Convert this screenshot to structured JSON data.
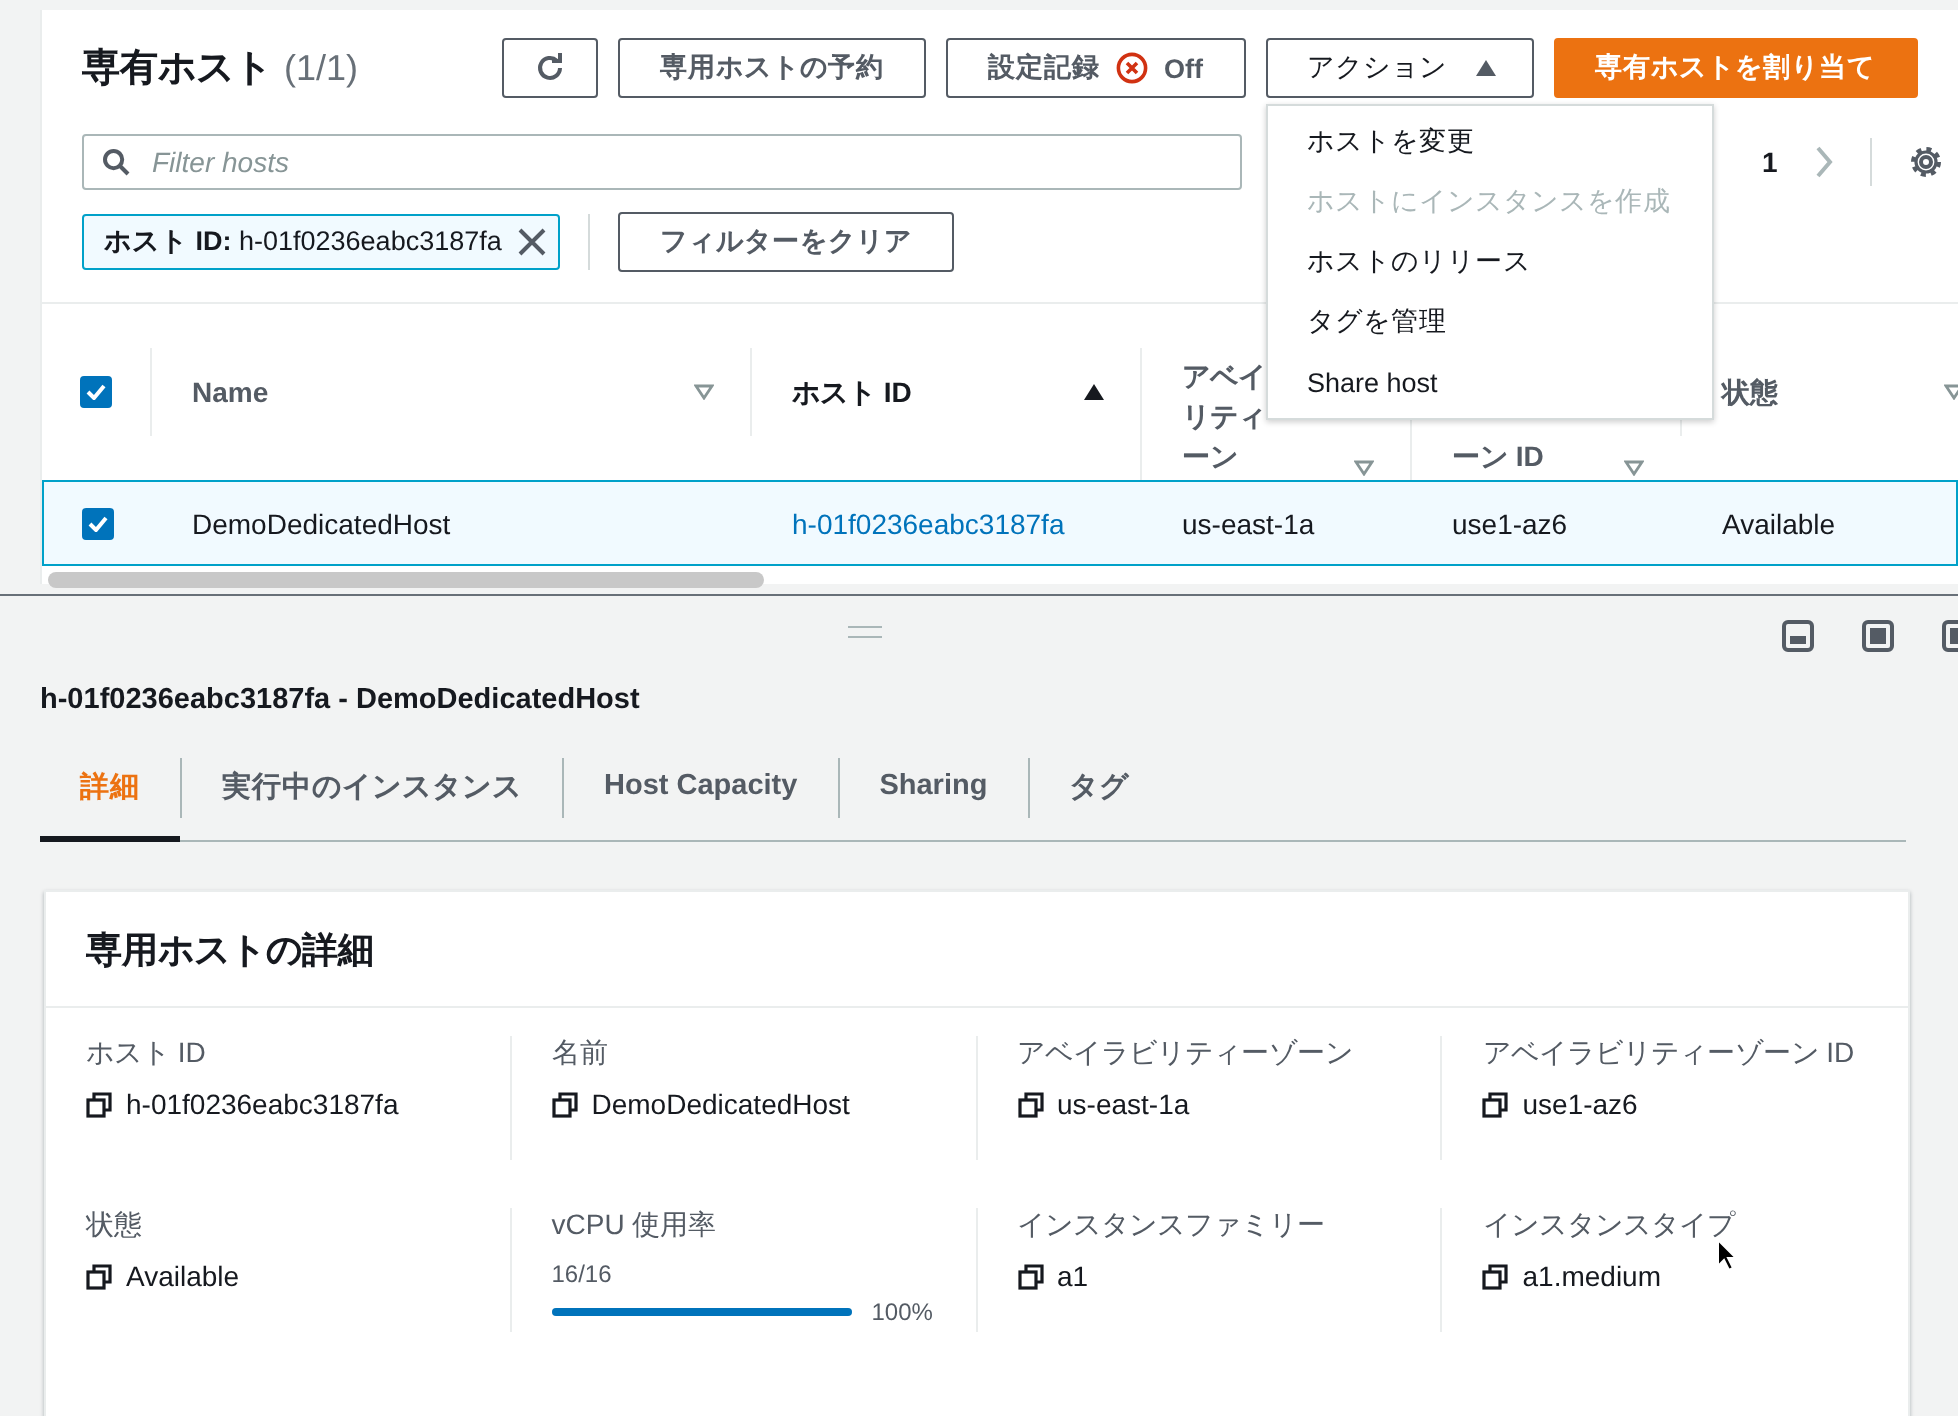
{
  "header": {
    "title": "専有ホスト",
    "count": "(1/1)"
  },
  "toolbar": [
    {
      "kind": "refresh"
    },
    {
      "kind": "text",
      "label": "専用ホストの予約"
    },
    {
      "kind": "toggle",
      "label": "設定記録",
      "value": "Off"
    },
    {
      "kind": "dropdown",
      "label": "アクション",
      "expanded": true
    },
    {
      "kind": "primary",
      "label": "専有ホストを割り当て"
    }
  ],
  "action_menu": [
    {
      "label": "ホストを変更",
      "disabled": false
    },
    {
      "label": "ホストにインスタンスを作成",
      "disabled": true
    },
    {
      "label": "ホストのリリース",
      "disabled": false
    },
    {
      "label": "タグを管理",
      "disabled": false
    },
    {
      "label": "Share host",
      "disabled": false
    }
  ],
  "search": {
    "placeholder": "Filter hosts"
  },
  "pagination": {
    "page": "1"
  },
  "filter_token": {
    "key": "ホスト ID:",
    "value": "h-01f0236eabc3187fa"
  },
  "clear_filters": "フィルターをクリア",
  "table": {
    "all_checked": true,
    "columns": [
      {
        "lines": [
          "Name"
        ],
        "sorted": false
      },
      {
        "lines": [
          "ホスト ID"
        ],
        "sorted": true
      },
      {
        "lines": [
          "アベイ",
          "リティ",
          "ーン"
        ],
        "sorted": false
      },
      {
        "lines": [
          "ーン ID"
        ],
        "sorted": false
      },
      {
        "lines": [
          "状態"
        ],
        "sorted": false
      }
    ],
    "rows": [
      {
        "selected": true,
        "cells": [
          {
            "text": "DemoDedicatedHost",
            "kind": "text"
          },
          {
            "text": "h-01f0236eabc3187fa",
            "kind": "link"
          },
          {
            "text": "us-east-1a",
            "kind": "text"
          },
          {
            "text": "use1-az6",
            "kind": "text"
          },
          {
            "text": "Available",
            "kind": "text"
          }
        ]
      }
    ]
  },
  "detail": {
    "title": "h-01f0236eabc3187fa - DemoDedicatedHost",
    "tabs": [
      {
        "label": "詳細",
        "selected": true
      },
      {
        "label": "実行中のインスタンス",
        "selected": false
      },
      {
        "label": "Host Capacity",
        "selected": false
      },
      {
        "label": "Sharing",
        "selected": false
      },
      {
        "label": "タグ",
        "selected": false
      }
    ],
    "section_title": "専用ホストの詳細",
    "fields": [
      {
        "label": "ホスト ID",
        "kind": "copy",
        "value": "h-01f0236eabc3187fa"
      },
      {
        "label": "名前",
        "kind": "copy",
        "value": "DemoDedicatedHost"
      },
      {
        "label": "アベイラビリティーゾーン",
        "kind": "copy",
        "value": "us-east-1a"
      },
      {
        "label": "アベイラビリティーゾーン ID",
        "kind": "copy",
        "value": "use1-az6"
      },
      {
        "label": "状態",
        "kind": "copy",
        "value": "Available"
      },
      {
        "label": "vCPU 使用率",
        "kind": "progress",
        "reading": "16/16",
        "level": 1,
        "percent": "100%"
      },
      {
        "label": "インスタンスファミリー",
        "kind": "copy",
        "value": "a1"
      },
      {
        "label": "インスタンスタイプ",
        "kind": "copy",
        "value": "a1.medium"
      }
    ]
  }
}
